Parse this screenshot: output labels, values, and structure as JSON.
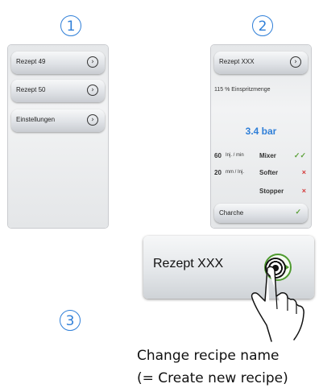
{
  "steps": {
    "one": "1",
    "two": "2",
    "three": "3"
  },
  "screen1": {
    "items": [
      {
        "label": "Rezept 49"
      },
      {
        "label": "Rezept 50"
      },
      {
        "label": "Einstellungen"
      }
    ]
  },
  "screen2": {
    "header": "Rezept XXX",
    "injection": "115 % Einspritzmenge",
    "pressure": "3.4 bar",
    "rows": [
      {
        "num": "60",
        "unit": "Inj. / min",
        "name": "Mixer",
        "status": "✓✓"
      },
      {
        "num": "20",
        "unit": "mm / Inj.",
        "name": "Softer",
        "status": "×"
      },
      {
        "num": "",
        "unit": "",
        "name": "Stopper",
        "status": "×"
      }
    ],
    "footer": "Charche",
    "footer_status": "✓"
  },
  "zoom": {
    "label": "Rezept XXX"
  },
  "caption": {
    "line1": "Change recipe name",
    "line2": "(= Create new recipe)"
  },
  "colors": {
    "accent": "#2f7fd8",
    "ok": "#5ca13a",
    "error": "#d43a3a"
  }
}
